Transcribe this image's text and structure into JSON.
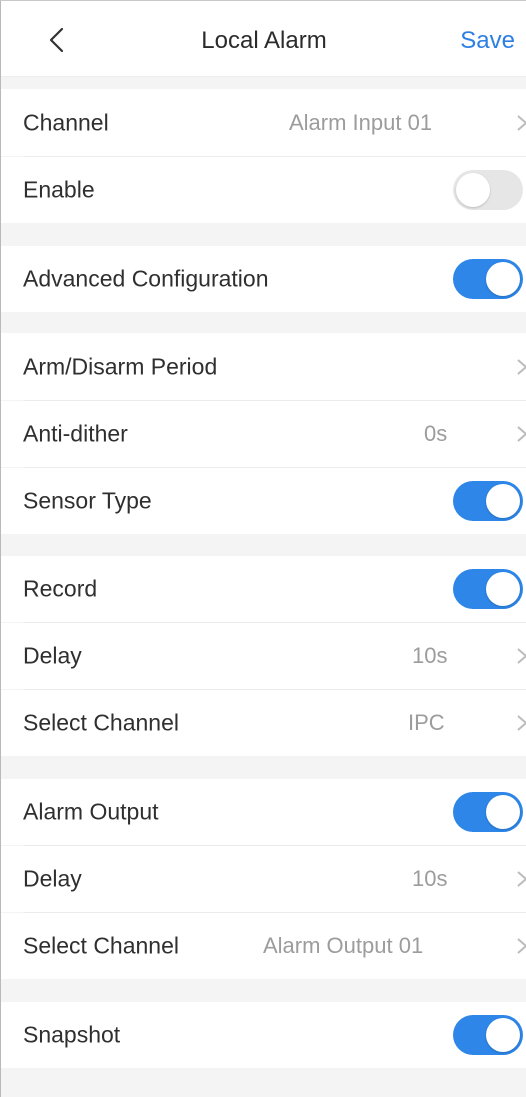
{
  "header": {
    "title": "Local Alarm",
    "save_label": "Save",
    "back_icon": "chevron-left-icon"
  },
  "channel": {
    "label": "Channel",
    "value": "Alarm Input 01"
  },
  "enable": {
    "label": "Enable",
    "on": false
  },
  "advanced": {
    "label": "Advanced Configuration",
    "on": true
  },
  "arm_period": {
    "label": "Arm/Disarm Period"
  },
  "anti_dither": {
    "label": "Anti-dither",
    "value": "0s"
  },
  "sensor_type": {
    "label": "Sensor Type",
    "on": true
  },
  "record": {
    "label": "Record",
    "on": true,
    "delay_label": "Delay",
    "delay_value": "10s",
    "channel_label": "Select Channel",
    "channel_value": "IPC"
  },
  "alarm_output": {
    "label": "Alarm Output",
    "on": true,
    "delay_label": "Delay",
    "delay_value": "10s",
    "channel_label": "Select Channel",
    "channel_value": "Alarm Output 01"
  },
  "snapshot": {
    "label": "Snapshot",
    "on": true
  },
  "colors": {
    "accent": "#2d86e8",
    "save": "#2d7fe3",
    "toggle_off": "#e6e6e6",
    "background": "#f4f4f4"
  }
}
